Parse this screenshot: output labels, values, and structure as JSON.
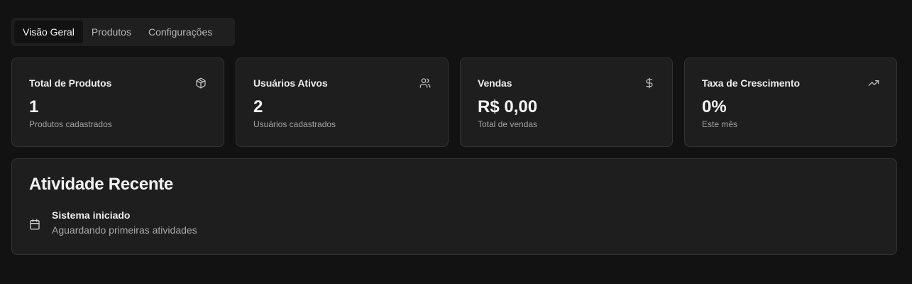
{
  "tabs": [
    {
      "label": "Visão Geral",
      "active": true
    },
    {
      "label": "Produtos",
      "active": false
    },
    {
      "label": "Configurações",
      "active": false
    }
  ],
  "stats": [
    {
      "title": "Total de Produtos",
      "value": "1",
      "subtitle": "Produtos cadastrados",
      "icon": "package-icon"
    },
    {
      "title": "Usuários Ativos",
      "value": "2",
      "subtitle": "Usuários cadastrados",
      "icon": "users-icon"
    },
    {
      "title": "Vendas",
      "value": "R$ 0,00",
      "subtitle": "Total de vendas",
      "icon": "dollar-sign-icon"
    },
    {
      "title": "Taxa de Crescimento",
      "value": "0%",
      "subtitle": "Este mês",
      "icon": "trending-up-icon"
    }
  ],
  "activity": {
    "title": "Atividade Recente",
    "items": [
      {
        "title": "Sistema iniciado",
        "description": "Aguardando primeiras atividades",
        "icon": "calendar-icon"
      }
    ]
  },
  "colors": {
    "background": "#121212",
    "card": "#1e1e1e",
    "border": "#333333",
    "text": "#f2f2f2",
    "muted": "#a3a3a3"
  }
}
